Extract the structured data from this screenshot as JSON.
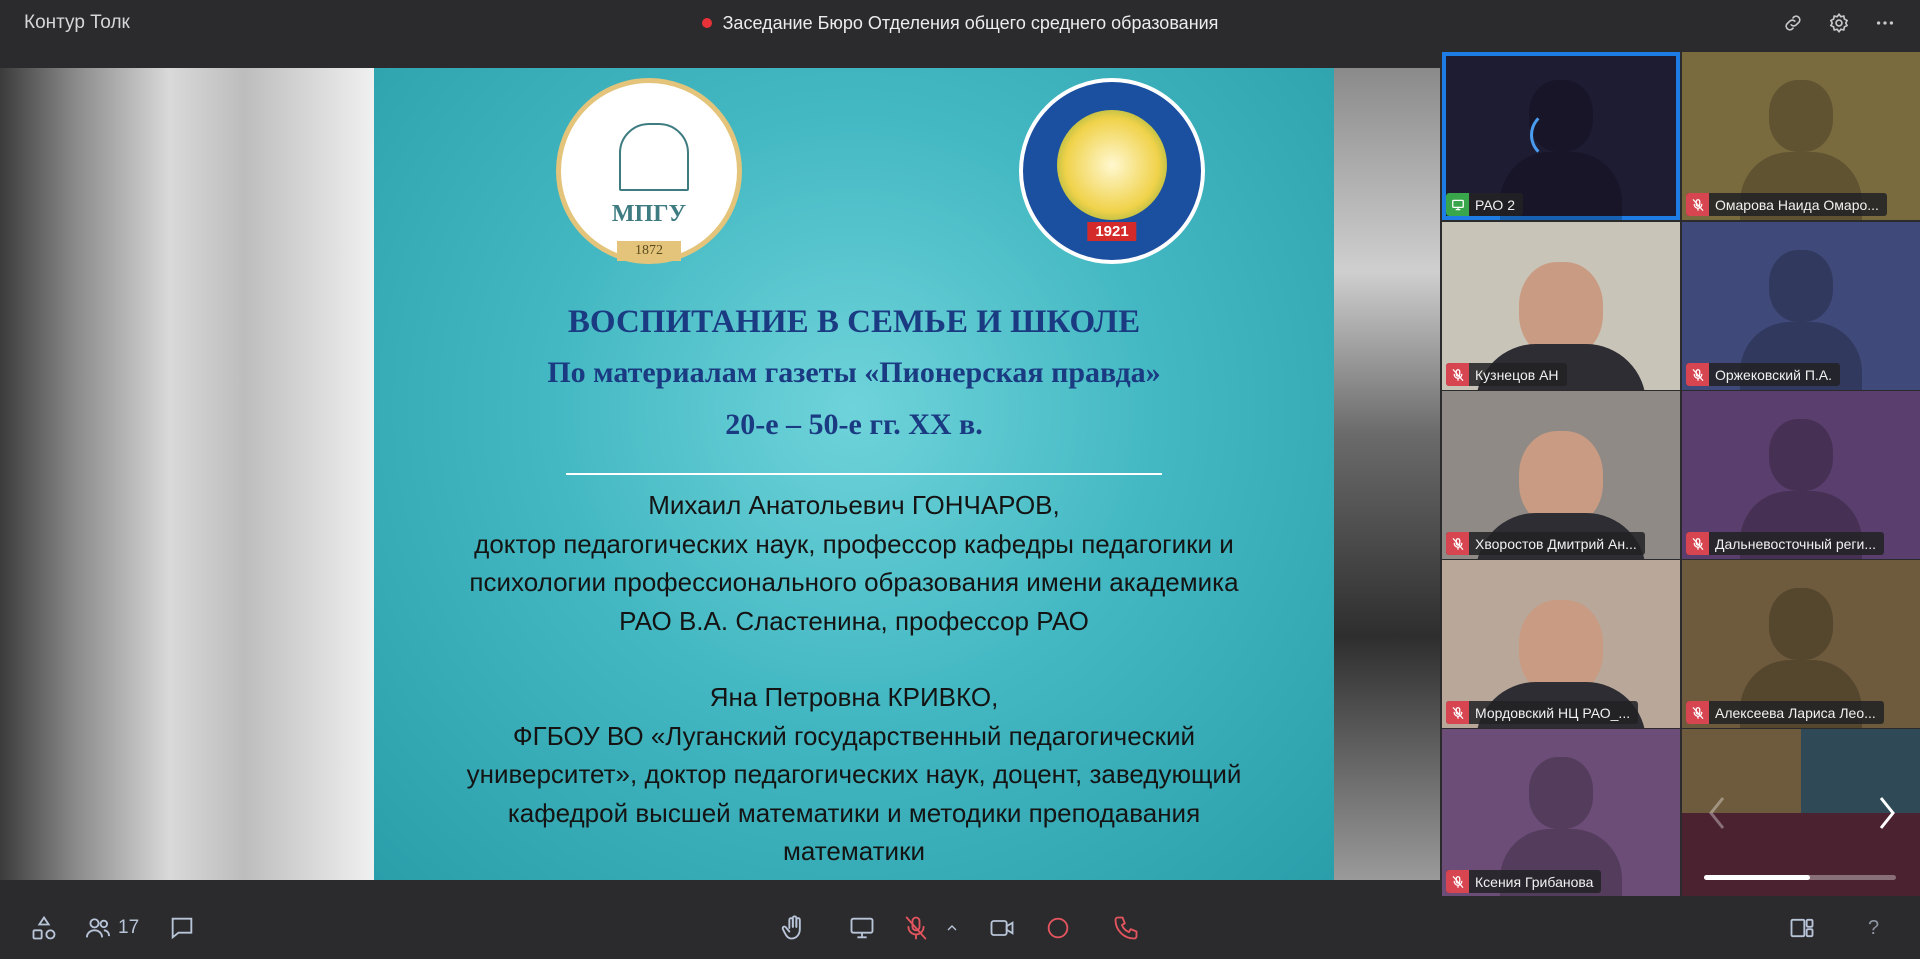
{
  "app": {
    "title": "Контур Толк"
  },
  "meeting": {
    "title": "Заседание Бюро Отделения общего среднего образования",
    "recording_color": "#e8323a"
  },
  "header": {
    "icons": [
      "link-icon",
      "gear-icon",
      "more-icon"
    ]
  },
  "slide": {
    "logo_left": {
      "text": "МПГУ",
      "year": "1872"
    },
    "logo_right": {
      "year": "1921"
    },
    "heading_1": "ВОСПИТАНИЕ В СЕМЬЕ И ШКОЛЕ",
    "heading_2": "По материалам газеты «Пионерская правда»",
    "heading_3": "20-е – 50-е гг. XX в.",
    "author_1": "Михаил Анатольевич ГОНЧАРОВ,\nдоктор педагогических наук, профессор кафедры педагогики и\nпсихологии профессионального образования имени академика\nРАО В.А. Сластенина, профессор РАО",
    "author_2": "Яна Петровна КРИВКО,\nФГБОУ ВО «Луганский государственный педагогический\nуниверситет», доктор педагогических наук, доцент, заведующий\nкафедрой высшей математики и методики преподавания\nматематики"
  },
  "participants": [
    {
      "name": "РАО 2",
      "status": "screen-share",
      "bg": "#1e1c33",
      "selected": true,
      "loading": true
    },
    {
      "name": "Омарова Наида Омаро...",
      "status": "muted",
      "bg": "#7a6b3f"
    },
    {
      "name": "Кузнецов АН",
      "status": "muted",
      "bg": "#c9c4b8",
      "video": true
    },
    {
      "name": "Оржековский П.А.",
      "status": "muted",
      "bg": "#3f4a7a"
    },
    {
      "name": "Хворостов Дмитрий Ан...",
      "status": "muted",
      "bg": "#8f8a86",
      "video": true
    },
    {
      "name": "Дальневосточный реги...",
      "status": "muted",
      "bg": "#5a3f6e"
    },
    {
      "name": "Мордовский НЦ РАО_...",
      "status": "muted",
      "bg": "#b9a79a",
      "video": true
    },
    {
      "name": "Алексеева Лариса Лео...",
      "status": "muted",
      "bg": "#6e5a3c"
    },
    {
      "name": "Ксения Грибанова",
      "status": "muted",
      "bg": "#6b4d77"
    }
  ],
  "overflow_tile": {
    "colors": [
      "#6e5a3c",
      "#2f4a56",
      "#4a2230",
      "#4a2230"
    ],
    "page_progress": 0.55
  },
  "toolbar": {
    "participants_count": "17",
    "left_icons": [
      "shapes-icon",
      "participants-icon",
      "chat-icon"
    ],
    "center_icons": [
      "raise-hand-icon",
      "screen-share-icon",
      "mic-off-icon",
      "chevron-up-icon",
      "camera-icon",
      "record-icon",
      "hang-up-icon"
    ],
    "right_icons": [
      "layout-icon",
      "help-icon"
    ],
    "help_label": "?"
  }
}
